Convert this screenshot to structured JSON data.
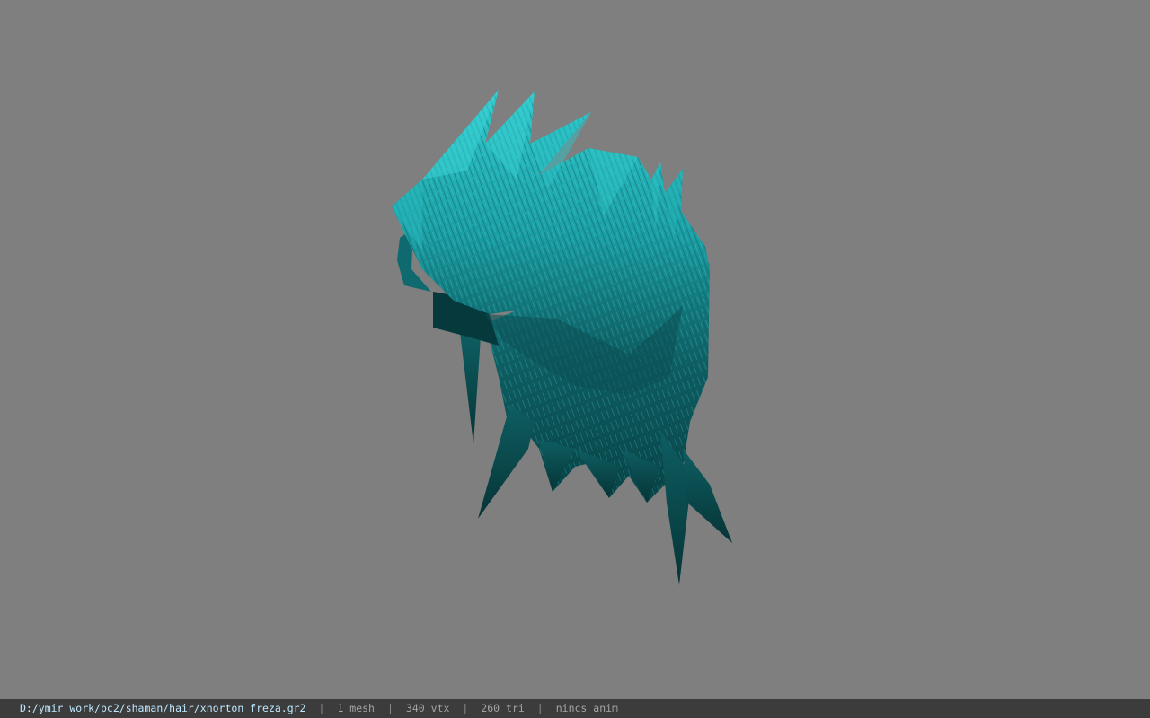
{
  "viewer": {
    "background_color": "#7f7f7f",
    "model_colors": {
      "highlight": "#2fc8cc",
      "mid": "#1b9ea3",
      "shadow": "#0e5e62",
      "deep": "#073f42"
    },
    "model_icon": "hair-mesh"
  },
  "status": {
    "file_path": "D:/ymir work/pc2/shaman/hair/xnorton_freza.gr2",
    "separator": "|",
    "mesh_count": "1 mesh",
    "vertex_count": "340 vtx",
    "triangle_count": "260 tri",
    "animation": "nincs anim"
  }
}
